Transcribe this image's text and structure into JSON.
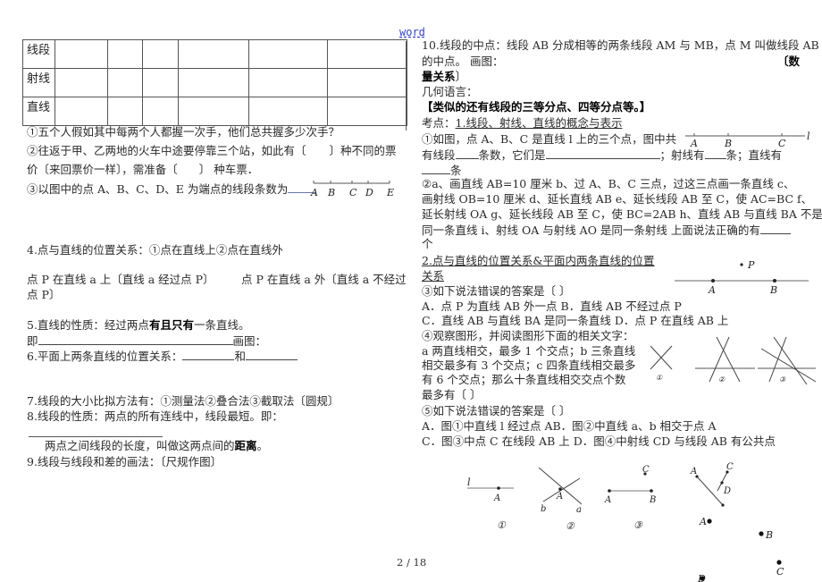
{
  "header": {
    "label": "word"
  },
  "footer": {
    "page": "2 / 18"
  },
  "table": {
    "rows": [
      {
        "label": "线段"
      },
      {
        "label": "射线"
      },
      {
        "label": "直线"
      }
    ],
    "empty_columns": 6
  },
  "left": {
    "q1": "①五个人假如其中每两个人都握一次手，他们总共握多少次手？",
    "q2_line1_a": "②往返于甲、乙两地的火车中途要停靠三个站，如此有〔",
    "q2_line1_b": "〕种不同的票",
    "q2_line2_a": "价〔来回票价一样〕，需准备〔",
    "q2_line2_b": "〕 种车票．",
    "q3": "③以图中的点 A、B、C、D、E 为端点的线段条数为",
    "q3_figure_points": [
      "A",
      "B",
      "C",
      "D",
      "E"
    ],
    "s4": "4.点与直线的位置关系：①点在直线上②点在直线外",
    "s4_a": "点 P 在直线 a 上〔直线 a 经过点 P〕",
    "s4_b": "点 P 在直线 a 外〔直线 a 不经过",
    "s4_c": "点 P〕",
    "s5_a": "5.直线的性质：经过两点",
    "s5_bold": "有且只有",
    "s5_b": "一条直线。",
    "s5_line2_a": "即",
    "s5_line2_b": "画图：",
    "s6_a": "6.平面上两条直线的位置关系：",
    "s6_b": "和",
    "s7": "7.线段的大小比拟方法有：①测量法②叠合法③截取法〔圆规〕",
    "s8": "8.线段的性质：两点的所有连线中，线段最短。即：",
    "dist_a": "两点之间线段的长度，叫做这两点间的",
    "dist_bold": "距离",
    "dist_b": "。",
    "s9": "9.线段与线段和差的画法：〔尺规作图〕"
  },
  "right": {
    "s10_line1": "10.线段的中点：线段 AB 分成相等的两条线段 AM 与 MB，点 M 叫做线段 AB",
    "s10_line2": "的中点。  画图：",
    "s10_bold_a": "〔数",
    "s10_bold_b": "量关系",
    "s10_bold_c": "〕",
    "geo_lang": "几何语言：",
    "similar": "【类似的还有线段的三等分点、四等分点等。】",
    "kp_prefix": "考点：",
    "kp_title": "1.线段、射线、直线的概念与表示",
    "k1_line1": "①如图，点 A、B、C 是直线 l 上的三个点，图中共",
    "k1_line2_a": "有线段",
    "k1_line2_b": "条数，它们是",
    "k1_line2_c": "；射线有",
    "k1_line2_d": "条；直线有",
    "k1_line3": "条",
    "k1_figure": {
      "points": [
        "A",
        "B",
        "C"
      ],
      "line_label": "l"
    },
    "k2_line1": "②a、画直线 AB=10 厘米   b、过 A、B、C 三点，过这三点画一条直线 c、",
    "k2_line2": "画射线 OB=10 厘米  d、延长直线 AB   e、延长线段 AB 至 C，使 AC=BC   f、",
    "k2_line3": "延长射线 OA  g、延长线段 AB 至 C，使 BC=2AB   h、直线 AB 与直线 BA 不是",
    "k2_line4": "同一条直线   i、射线 OA 与射线 AO 是同一条射线  上面说法正确的有",
    "k2_line5": "个",
    "kp2_line1": "2.点与直线的位置关系&平面内两条直线的位置",
    "kp2_line2": "关系",
    "k3_title": "③如下说法错误的答案是〔        〕",
    "k3_ab": "A．点 P 为直线 AB 外一点 B．直线 AB 不经过点 P",
    "k3_cd": "C．直线 AB 与直线 BA 是同一条直线 D．点 P 在直线 AB 上",
    "k3_figure": {
      "points": [
        "A",
        "B"
      ],
      "outside_point": "P"
    },
    "k4_line1": "④观察图形，并阅读图形下面的相关文字：",
    "k4_line2": "a 两直线相交，最多 1 个交点；b 三条直线",
    "k4_line3": "相交最多有 3 个交点；c 四条直线相交最多",
    "k4_line4": "有 6 个交点；那么十条直线相交交点个数",
    "k4_line5": "最多有〔        〕",
    "k4_figure_labels": [
      "①",
      "②",
      "③"
    ],
    "k5_title": "⑤如下说法错误的答案是〔        〕",
    "k5_ab": "A．图①中直线 l 经过点 AB．图②中直线 a、b 相交于点 A",
    "k5_cd": "C．图③中点 C 在线段 AB 上 D．图④中射线 CD 与线段 AB 有公共点",
    "k5_figures": {
      "fig1": {
        "line_label": "l",
        "point": "A",
        "caption": "①"
      },
      "fig2": {
        "lines": [
          "a",
          "b"
        ],
        "point": "A",
        "caption": "②"
      },
      "fig3": {
        "segment": [
          "A",
          "B"
        ],
        "outside_point": "C",
        "caption": "③"
      },
      "fig4": {
        "segment": [
          "A",
          "B"
        ],
        "ray": [
          "C",
          "D"
        ]
      },
      "scatter_points": [
        "A",
        "B",
        "C",
        "D"
      ]
    }
  }
}
